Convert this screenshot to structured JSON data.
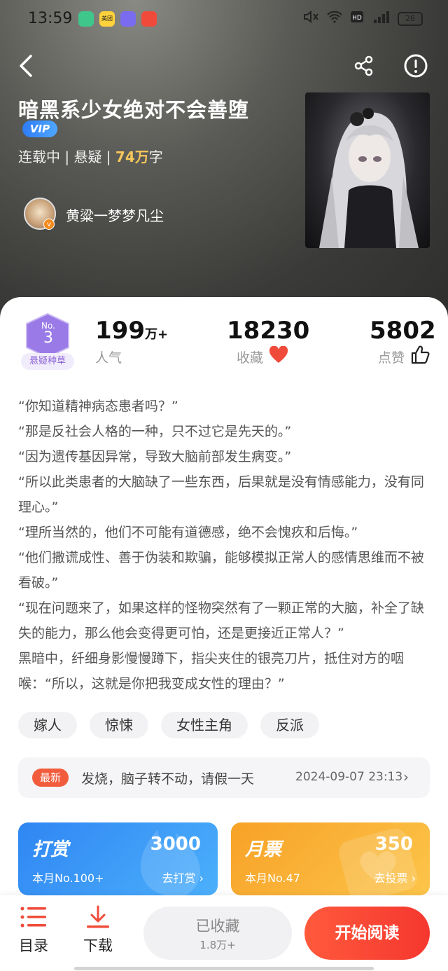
{
  "status_bar": {
    "time": "13:59",
    "apps": [
      "green-app-icon",
      "meituan-icon",
      "purple-app-icon",
      "red-app-icon"
    ],
    "meituan_label": "美团",
    "battery": "26"
  },
  "book": {
    "title": "暗黑系少女绝对不会善堕",
    "vip": "VIP",
    "status": "连载中",
    "genre": "悬疑",
    "word_count": "74万",
    "word_unit": "字",
    "separator": " | "
  },
  "author": {
    "name": "黄粱一梦梦凡尘",
    "badge": "v"
  },
  "rank": {
    "prefix": "No.",
    "number": "3",
    "label": "悬疑种草"
  },
  "stats": {
    "popularity_value": "199",
    "popularity_unit": "万+",
    "popularity_label": "人气",
    "collect_value": "18230",
    "collect_label": "收藏",
    "like_value": "5802",
    "like_label": "点赞"
  },
  "description": [
    "“你知道精神病态患者吗？”",
    "“那是反社会人格的一种，只不过它是先天的。”",
    "“因为遗传基因异常，导致大脑前部发生病变。”",
    "“所以此类患者的大脑缺了一些东西，后果就是没有情感能力，没有同理心。”",
    "“理所当然的，他们不可能有道德感，绝不会愧疚和后悔。”",
    "“他们撒谎成性、善于伪装和欺骗，能够模拟正常人的感情思维而不被看破。”",
    "“现在问题来了，如果这样的怪物突然有了一颗正常的大脑，补全了缺失的能力，那么他会变得更可怕，还是更接近正常人？”",
    "黑暗中，纤细身影慢慢蹲下，指尖夹住的银亮刀片，抵住对方的咽喉：“所以，这就是你把我变成女性的理由？”"
  ],
  "tags": [
    "嫁人",
    "惊悚",
    "女性主角",
    "反派"
  ],
  "latest": {
    "badge": "最新",
    "chapter": "发烧，脑子转不动，请假一天",
    "time": "2024-09-07 23:13",
    "arrow": "›"
  },
  "tip": {
    "title": "打赏",
    "count": "3000",
    "rank": "本月No.100+",
    "action": "去打赏",
    "color": "#2f8ff5"
  },
  "ticket": {
    "title": "月票",
    "count": "350",
    "rank": "本月No.47",
    "action": "去投票",
    "color": "#f8a92a"
  },
  "bottom_bar": {
    "toc_label": "目录",
    "download_label": "下载",
    "collected_label": "已收藏",
    "collected_count": "1.8万+",
    "read_label": "开始阅读"
  }
}
